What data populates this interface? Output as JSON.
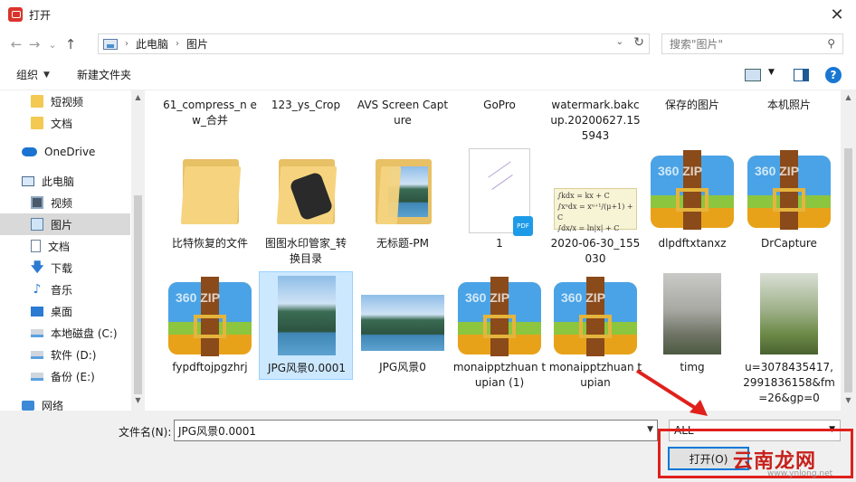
{
  "window": {
    "title": "打开",
    "close_glyph": "✕"
  },
  "nav": {
    "back_glyph": "←",
    "forward_glyph": "→",
    "history_glyph": "⌄",
    "up_glyph": "↑",
    "path": [
      "此电脑",
      "图片"
    ],
    "search_placeholder": "搜索\"图片\""
  },
  "toolbar": {
    "organize": "组织",
    "new_folder": "新建文件夹",
    "help": "?"
  },
  "sidebar": {
    "items": [
      {
        "label": "短视频",
        "icon": "folder-icon"
      },
      {
        "label": "文档",
        "icon": "folder-icon"
      },
      {
        "label": "OneDrive",
        "icon": "cloud-icon"
      },
      {
        "label": "此电脑",
        "icon": "computer-icon"
      },
      {
        "label": "视频",
        "icon": "video-icon"
      },
      {
        "label": "图片",
        "icon": "pictures-icon"
      },
      {
        "label": "文档",
        "icon": "document-icon"
      },
      {
        "label": "下载",
        "icon": "download-icon"
      },
      {
        "label": "音乐",
        "icon": "music-icon"
      },
      {
        "label": "桌面",
        "icon": "desktop-icon"
      },
      {
        "label": "本地磁盘 (C:)",
        "icon": "disk-icon"
      },
      {
        "label": "软件 (D:)",
        "icon": "disk-icon"
      },
      {
        "label": "备份 (E:)",
        "icon": "disk-icon"
      },
      {
        "label": "网络",
        "icon": "network-icon"
      }
    ]
  },
  "files": {
    "row1": [
      "61_compress_n ew_合并",
      "123_ys_Crop",
      "AVS Screen Capture",
      "GoPro",
      "watermark.bakc up.20200627.15 5943",
      "保存的图片",
      "本机照片"
    ],
    "row2": [
      "比特恢复的文件",
      "图图水印管家_转 换目录",
      "无标题-PM",
      "1",
      "2020-06-30_155 030",
      "dlpdftxtanxz",
      "DrCapture"
    ],
    "row3": [
      "fypdftojpgzhrj",
      "JPG风景0.0001",
      "JPG风景0",
      "monaipptzhuan tupian (1)",
      "monaipptzhuan tupian",
      "timg",
      "u=3078435417, 2991836158&fm =26&gp=0"
    ],
    "zip_badge": "360 ZIP",
    "pdf_badge": "PDF",
    "formula_lines": [
      "∫kdx = kx + C",
      "∫xᵘdx = xᵘ⁺¹/(μ+1) + C",
      "∫dx/x = ln|x| + C"
    ]
  },
  "bottom": {
    "filename_label": "文件名(N):",
    "filename_value": "JPG风景0.0001",
    "filetype_value": "ALL",
    "open_button": "打开(O)"
  },
  "watermark": {
    "text": "云南龙网",
    "sub": "www.ynlong.net"
  },
  "colors": {
    "accent": "#0078d7",
    "selection": "#cce8ff",
    "highlight": "#e0201b"
  }
}
